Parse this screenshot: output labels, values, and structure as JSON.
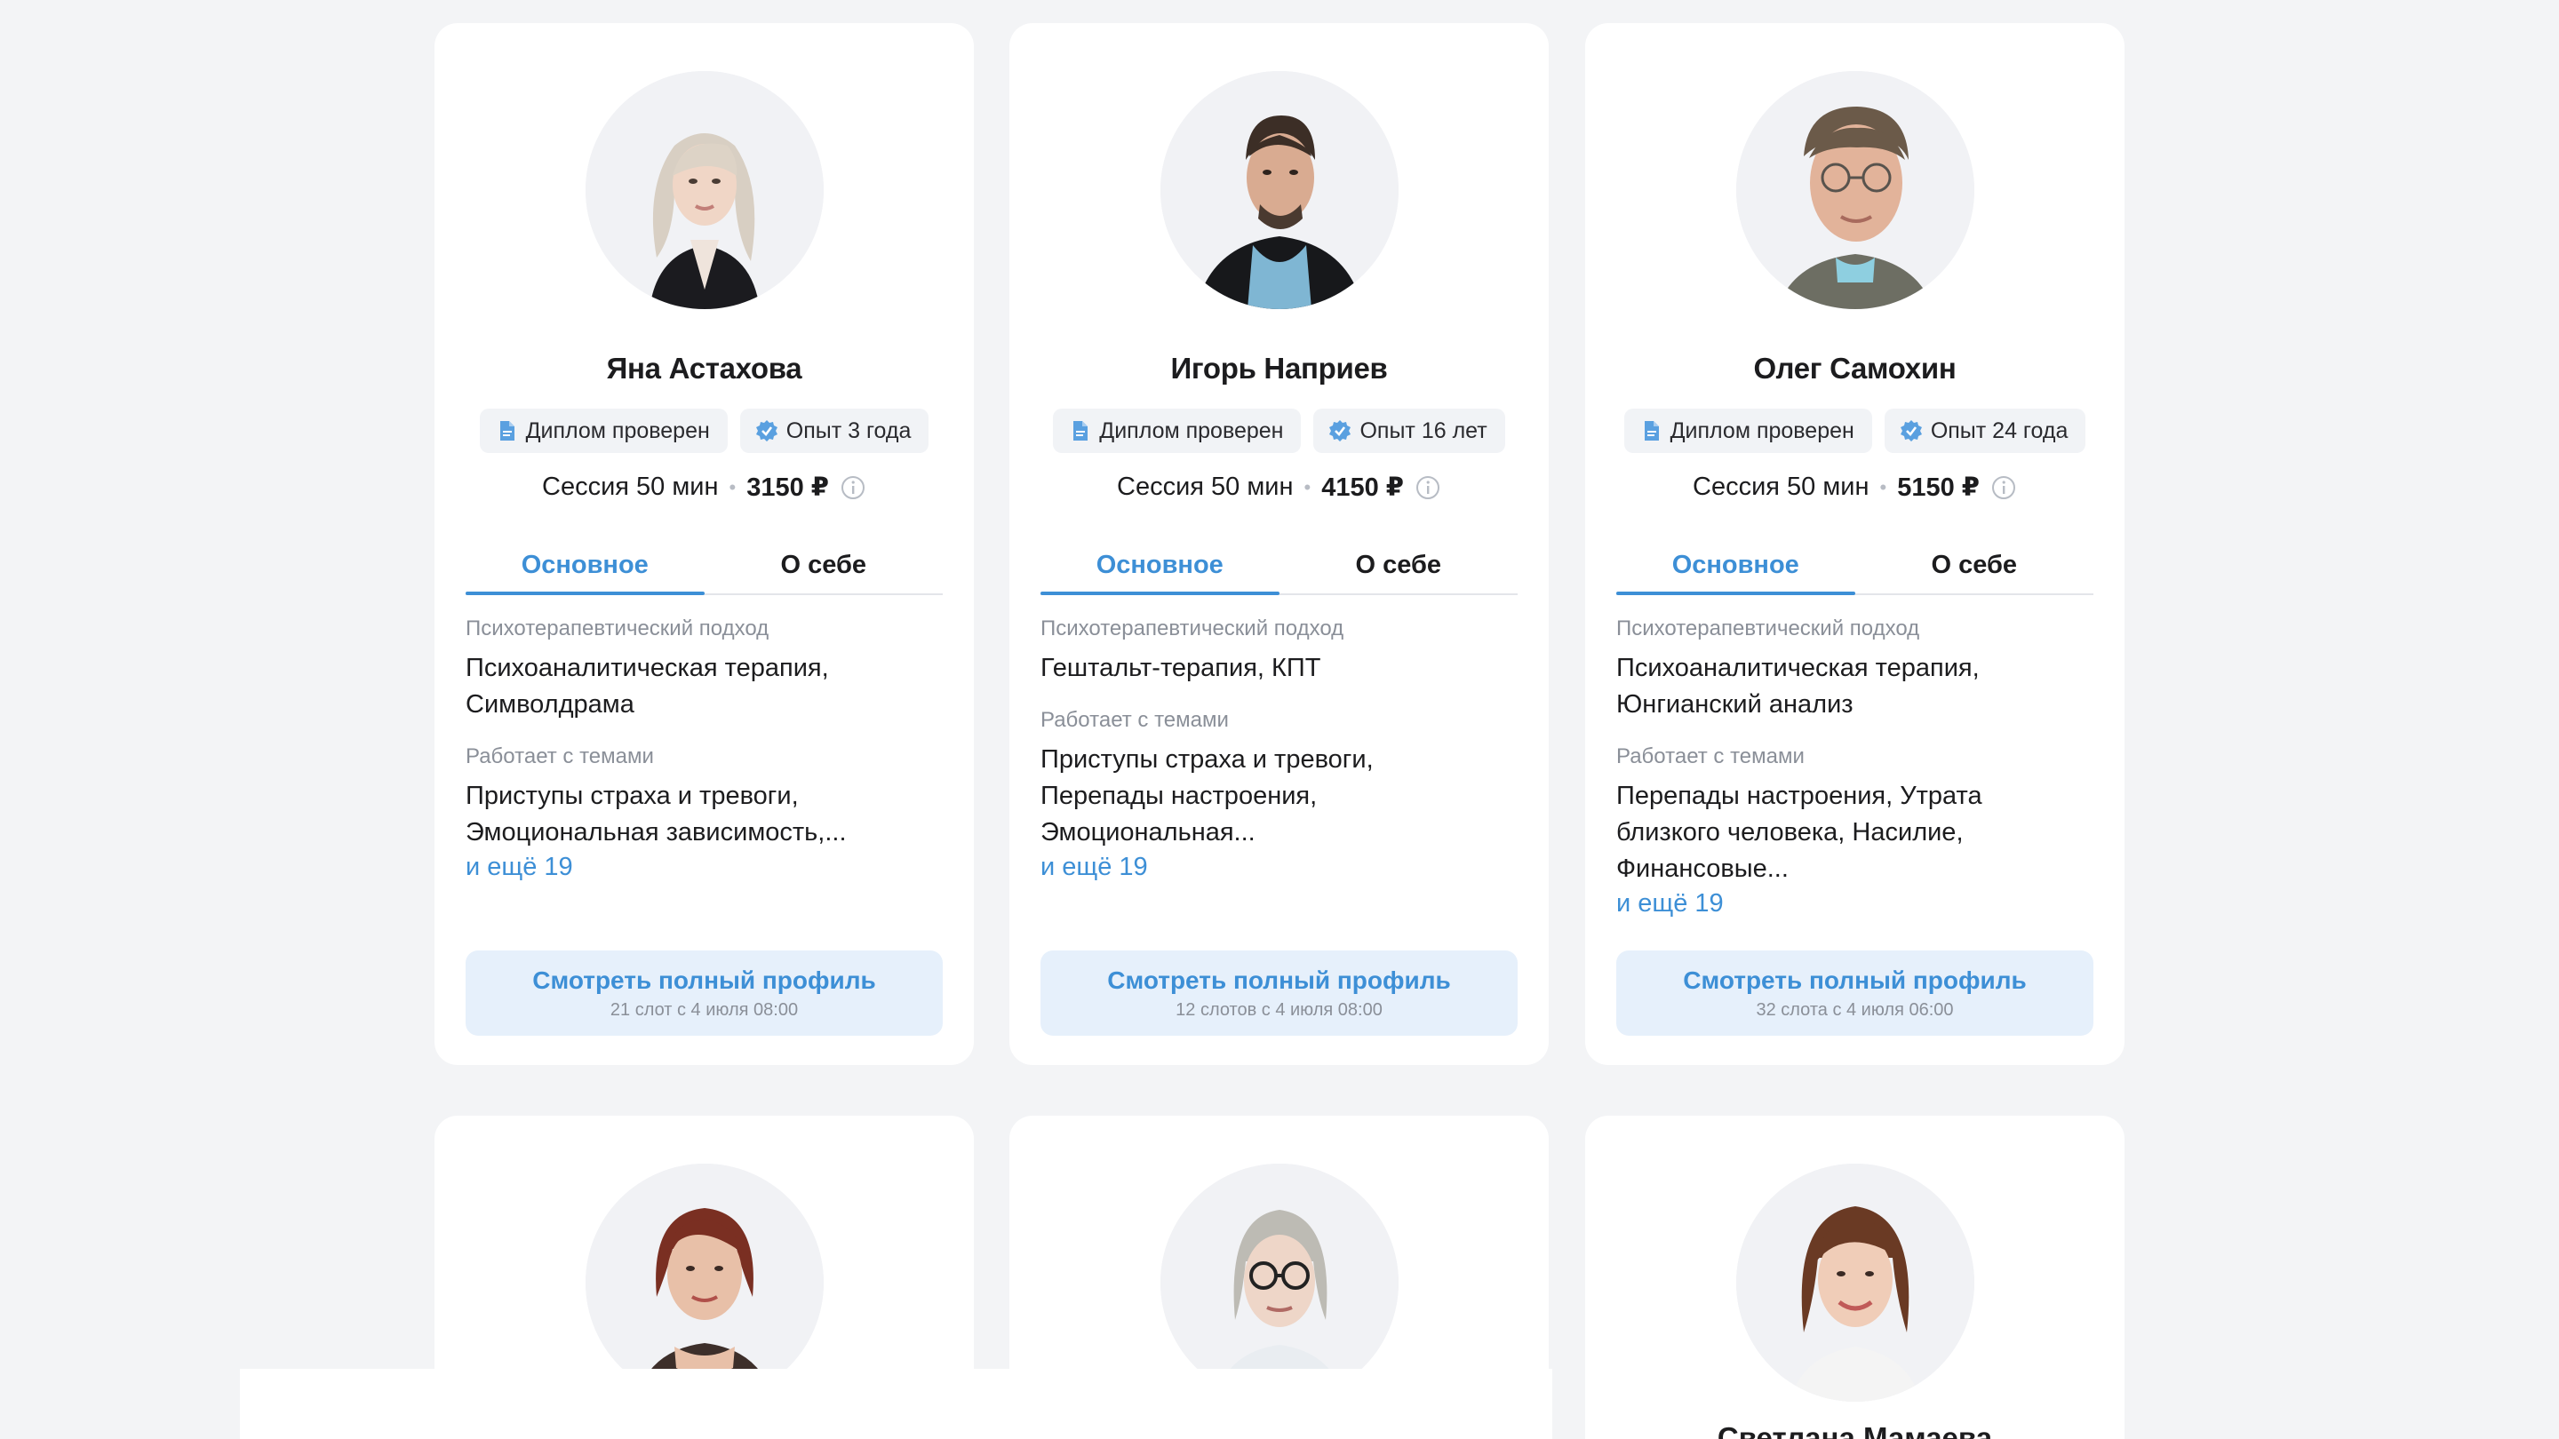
{
  "cards": [
    {
      "name": "Яна Астахова",
      "diploma": "Диплом проверен",
      "experience": "Опыт 3 года",
      "session": "Сессия 50 мин",
      "price": "3150 ₽",
      "tab_main": "Основное",
      "tab_about": "О себе",
      "approach_label": "Психотерапевтический подход",
      "approach": "Психоаналитическая терапия, Символдрама",
      "topics_label": "Работает с темами",
      "topics": "Приступы страха и тревоги, Эмоциональная зависимость,...",
      "more": "и ещё 19",
      "cta": "Смотреть полный профиль",
      "cta_sub": "21 слот с 4 июля 08:00"
    },
    {
      "name": "Игорь Наприев",
      "diploma": "Диплом проверен",
      "experience": "Опыт 16 лет",
      "session": "Сессия 50 мин",
      "price": "4150 ₽",
      "tab_main": "Основное",
      "tab_about": "О себе",
      "approach_label": "Психотерапевтический подход",
      "approach": "Гештальт-терапия, КПТ",
      "topics_label": "Работает с темами",
      "topics": "Приступы страха и тревоги, Перепады настроения, Эмоциональная...",
      "more": "и ещё 19",
      "cta": "Смотреть полный профиль",
      "cta_sub": "12 слотов с 4 июля 08:00"
    },
    {
      "name": "Олег Самохин",
      "diploma": "Диплом проверен",
      "experience": "Опыт 24 года",
      "session": "Сессия 50 мин",
      "price": "5150 ₽",
      "tab_main": "Основное",
      "tab_about": "О себе",
      "approach_label": "Психотерапевтический подход",
      "approach": "Психоаналитическая терапия, Юнгианский анализ",
      "topics_label": "Работает с темами",
      "topics": "Перепады настроения, Утрата близкого человека, Насилие, Финансовые...",
      "more": "и ещё 19",
      "cta": "Смотреть полный профиль",
      "cta_sub": "32 слота с 4 июля 06:00"
    }
  ],
  "bottom_cards": [
    {
      "name": ""
    },
    {
      "name": ""
    },
    {
      "name": "Светлана Мамаева"
    }
  ],
  "icons": {
    "diploma": "document-icon",
    "experience": "verified-badge-icon",
    "price_info": "info-icon"
  },
  "colors": {
    "accent": "#3d8fd6",
    "background": "#f3f4f6",
    "card": "#ffffff",
    "cta_background": "#e6f0fb"
  }
}
